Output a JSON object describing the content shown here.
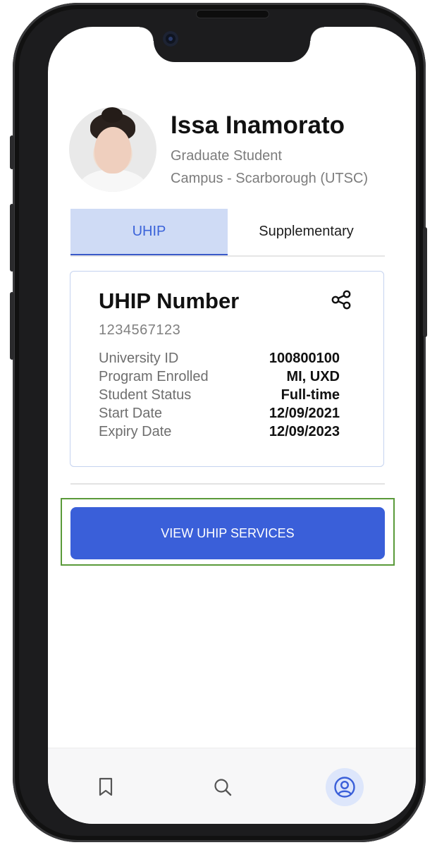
{
  "profile": {
    "name": "Issa Inamorato",
    "role": "Graduate Student",
    "campus": "Campus - Scarborough (UTSC)"
  },
  "tabs": [
    {
      "label": "UHIP",
      "active": true
    },
    {
      "label": "Supplementary",
      "active": false
    }
  ],
  "card": {
    "title": "UHIP Number",
    "number": "1234567123",
    "share_icon": "share-icon",
    "rows": [
      {
        "label": "University ID",
        "value": "100800100"
      },
      {
        "label": "Program Enrolled",
        "value": "MI, UXD"
      },
      {
        "label": "Student Status",
        "value": "Full-time"
      },
      {
        "label": "Start Date",
        "value": "12/09/2021"
      },
      {
        "label": "Expiry Date",
        "value": "12/09/2023"
      }
    ]
  },
  "action_button": {
    "label": "VIEW UHIP SERVICES"
  },
  "bottom_nav": [
    {
      "icon": "bookmark-icon",
      "active": false
    },
    {
      "icon": "search-icon",
      "active": false
    },
    {
      "icon": "profile-icon",
      "active": true
    }
  ],
  "colors": {
    "accent": "#3a5fd9",
    "active_tab_bg": "#cfdbf5",
    "highlight_border": "#5a9a3a"
  }
}
